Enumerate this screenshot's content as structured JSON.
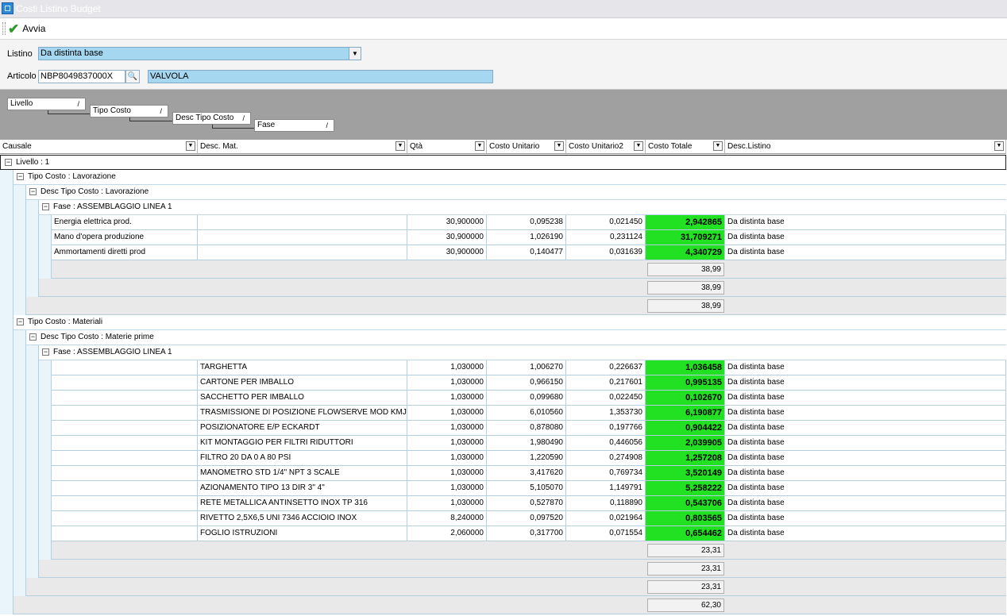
{
  "window": {
    "title": "Costi Listino Budget"
  },
  "toolbar": {
    "run_label": "Avvia"
  },
  "form": {
    "listino_label": "Listino",
    "listino_value": "Da distinta base",
    "articolo_label": "Articolo",
    "articolo_code": "NBP8049837000X",
    "articolo_desc": "VALVOLA"
  },
  "group_panel": {
    "chips": [
      "Livello",
      "Tipo Costo",
      "Desc Tipo Costo",
      "Fase"
    ]
  },
  "grid": {
    "columns": [
      "Causale",
      "Desc. Mat.",
      "Qtà",
      "Costo Unitario",
      "Costo Unitario2",
      "Costo Totale",
      "Desc.Listino"
    ],
    "livello_label": "Livello : 1",
    "grand_total": "62,30",
    "groups": [
      {
        "tipo_label": "Tipo Costo : Lavorazione",
        "desc_label": "Desc Tipo Costo : Lavorazione",
        "fase_label": "Fase : ASSEMBLAGGIO LINEA 1",
        "rows": [
          {
            "causale": "Energia elettrica prod.",
            "desc": "",
            "qta": "30,900000",
            "cu": "0,095238",
            "cu2": "0,021450",
            "tot": "2,942865",
            "listino": "Da distinta base"
          },
          {
            "causale": "Mano d'opera produzione",
            "desc": "",
            "qta": "30,900000",
            "cu": "1,026190",
            "cu2": "0,231124",
            "tot": "31,709271",
            "listino": "Da distinta base"
          },
          {
            "causale": "Ammortamenti diretti prod",
            "desc": "",
            "qta": "30,900000",
            "cu": "0,140477",
            "cu2": "0,031639",
            "tot": "4,340729",
            "listino": "Da distinta base"
          }
        ],
        "fase_total": "38,99",
        "desc_total": "38,99",
        "tipo_total": "38,99"
      },
      {
        "tipo_label": "Tipo Costo : Materiali",
        "desc_label": "Desc Tipo Costo : Materie prime",
        "fase_label": "Fase : ASSEMBLAGGIO LINEA 1",
        "rows": [
          {
            "causale": "",
            "desc": "TARGHETTA",
            "qta": "1,030000",
            "cu": "1,006270",
            "cu2": "0,226637",
            "tot": "1,036458",
            "listino": "Da distinta base"
          },
          {
            "causale": "",
            "desc": "CARTONE PER IMBALLO",
            "qta": "1,030000",
            "cu": "0,966150",
            "cu2": "0,217601",
            "tot": "0,995135",
            "listino": "Da distinta base"
          },
          {
            "causale": "",
            "desc": "SACCHETTO PER IMBALLO",
            "qta": "1,030000",
            "cu": "0,099680",
            "cu2": "0,022450",
            "tot": "0,102670",
            "listino": "Da distinta base"
          },
          {
            "causale": "",
            "desc": "TRASMISSIONE DI POSIZIONE FLOWSERVE MOD KMJM",
            "qta": "1,030000",
            "cu": "6,010560",
            "cu2": "1,353730",
            "tot": "6,190877",
            "listino": "Da distinta base"
          },
          {
            "causale": "",
            "desc": "POSIZIONATORE E/P ECKARDT",
            "qta": "1,030000",
            "cu": "0,878080",
            "cu2": "0,197766",
            "tot": "0,904422",
            "listino": "Da distinta base"
          },
          {
            "causale": "",
            "desc": "KIT MONTAGGIO PER FILTRI RIDUTTORI",
            "qta": "1,030000",
            "cu": "1,980490",
            "cu2": "0,446056",
            "tot": "2,039905",
            "listino": "Da distinta base"
          },
          {
            "causale": "",
            "desc": "FILTRO 20 DA 0 A 80 PSI",
            "qta": "1,030000",
            "cu": "1,220590",
            "cu2": "0,274908",
            "tot": "1,257208",
            "listino": "Da distinta base"
          },
          {
            "causale": "",
            "desc": "MANOMETRO STD 1/4\" NPT 3 SCALE",
            "qta": "1,030000",
            "cu": "3,417620",
            "cu2": "0,769734",
            "tot": "3,520149",
            "listino": "Da distinta base"
          },
          {
            "causale": "",
            "desc": "AZIONAMENTO TIPO 13 DIR 3\" 4\"",
            "qta": "1,030000",
            "cu": "5,105070",
            "cu2": "1,149791",
            "tot": "5,258222",
            "listino": "Da distinta base"
          },
          {
            "causale": "",
            "desc": "RETE METALLICA ANTINSETTO INOX TP 316",
            "qta": "1,030000",
            "cu": "0,527870",
            "cu2": "0,118890",
            "tot": "0,543706",
            "listino": "Da distinta base"
          },
          {
            "causale": "",
            "desc": "RIVETTO 2,5X6,5 UNI 7346 ACCIOIO INOX",
            "qta": "8,240000",
            "cu": "0,097520",
            "cu2": "0,021964",
            "tot": "0,803565",
            "listino": "Da distinta base"
          },
          {
            "causale": "",
            "desc": "FOGLIO ISTRUZIONI",
            "qta": "2,060000",
            "cu": "0,317700",
            "cu2": "0,071554",
            "tot": "0,654462",
            "listino": "Da distinta base"
          }
        ],
        "fase_total": "23,31",
        "desc_total": "23,31",
        "tipo_total": "23,31"
      }
    ]
  }
}
